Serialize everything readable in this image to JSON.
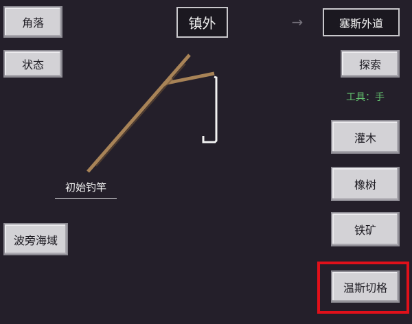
{
  "nav": {
    "corner_label": "角落",
    "status_label": "状态",
    "location_label": "镇外",
    "arrow_glyph": "→",
    "destination_label": "塞斯外道"
  },
  "actions": {
    "explore_label": "探索",
    "tool_text": "工具：手",
    "resources": [
      "灌木",
      "橡树",
      "铁矿",
      "温斯切格"
    ]
  },
  "fishing": {
    "rod_label": "初始钓竿",
    "sea_label": "波旁海域"
  },
  "colors": {
    "background": "#241f2a",
    "button_light": "#d3d2d6",
    "tool_text": "#63c26f",
    "rod_wood": "#a88357",
    "highlight": "#e0101a"
  }
}
